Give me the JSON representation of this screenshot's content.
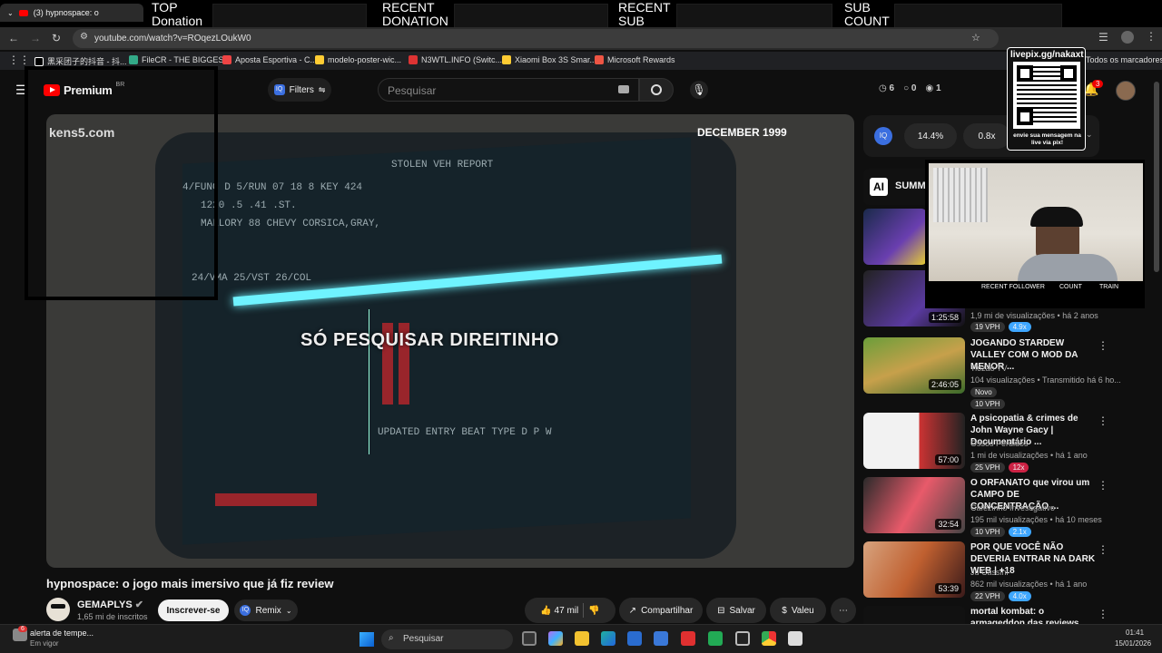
{
  "overlay": {
    "top_donation": [
      "TOP",
      "Donation"
    ],
    "recent_donation": [
      "RECENT",
      "DONATION"
    ],
    "recent_sub": [
      "RECENT",
      "SUB"
    ],
    "sub_count": [
      "SUB",
      "COUNT"
    ],
    "livepix_url": "livepix.gg/nakaxt",
    "livepix_caption": "envie sua mensagem na live via pix!",
    "webcam_labels": [
      "RECENT FOLLOWER",
      "COUNT",
      "TRAIN"
    ]
  },
  "browser": {
    "tab_title": "(3) hypnospace: o",
    "url": "youtube.com/watch?v=ROqezLOukW0",
    "bookmarks": [
      "黑采团子的抖音 - 抖...",
      "FileCR - THE BIGGES...",
      "Aposta Esportiva - C...",
      "modelo-poster-wic...",
      "N3WTL.INFO (Switc...",
      "Xiaomi Box 3S Smar...",
      "Microsoft Rewards"
    ],
    "all_bookmarks": "Todos os marcadores"
  },
  "header": {
    "logo": "Premium",
    "region": "BR",
    "filters": "Filters",
    "search_placeholder": "Pesquisar",
    "stats": [
      "6",
      "0",
      "1"
    ],
    "notif_count": "3"
  },
  "video": {
    "watermark": "kens5.com",
    "date_caption": "DECEMBER 1999",
    "subtitle": "SÓ PESQUISAR DIREITINHO",
    "title": "hypnospace: o jogo mais imersivo que já fiz review",
    "channel": "GEMAPLYS",
    "subs": "1,65 mi de inscritos",
    "subscribe": "Inscrever-se",
    "remix": "Remix",
    "likes": "47 mil",
    "share": "Compartilhar",
    "save": "Salvar",
    "thanks": "Valeu"
  },
  "sidebar": {
    "iq_stats": [
      "14.4%",
      "0.8x"
    ],
    "summary": "SUMM",
    "recs": [
      {
        "title": "",
        "channel": "",
        "meta": "1,9 mi de visualizações • há 2 anos",
        "duration": "1:25:58",
        "vph": "19 VPH",
        "mult": "4.9x"
      },
      {
        "title": "JOGANDO STARDEW VALLEY COM O MOD DA MENOR ...",
        "channel": "Tiozão TV",
        "meta": "104 visualizações • Transmitido há 6 ho...",
        "duration": "2:46:05",
        "badge": "Novo",
        "vph": "10 VPH",
        "mult": ""
      },
      {
        "title": "A psicopatia & crimes de John Wayne Gacy | Documentário ...",
        "channel": "Ossos Perdidos",
        "meta": "1 mi de visualizações • há 1 ano",
        "duration": "57:00",
        "vph": "25 VPH",
        "mult": "12x"
      },
      {
        "title": "O ORFANATO que virou um CAMPO DE CONCENTRAÇÃO ...",
        "channel": "Cafezinho Investigativo",
        "meta": "195 mil visualizações • há 10 meses",
        "duration": "32:54",
        "vph": "10 VPH",
        "mult": "2.1x"
      },
      {
        "title": "POR QUE VOCÊ NÃO DEVERIA ENTRAR NA DARK WEB | +18",
        "channel": "Ju Cassini",
        "meta": "862 mil visualizações • há 1 ano",
        "duration": "53:39",
        "vph": "22 VPH",
        "mult": "4.0x"
      },
      {
        "title": "mortal kombat: o armageddon das reviews",
        "channel": "",
        "meta": "",
        "duration": "",
        "vph": "",
        "mult": ""
      }
    ]
  },
  "taskbar": {
    "weather_title": "alerta de tempe...",
    "weather_sub": "Em vigor",
    "weather_badge": "6",
    "search": "Pesquisar",
    "time": "01:41",
    "date": "15/01/2026"
  },
  "colors": {
    "youtube_red": "#ff0000",
    "accent_blue": "#3ea6ff",
    "vph_red": "#cc2244"
  }
}
